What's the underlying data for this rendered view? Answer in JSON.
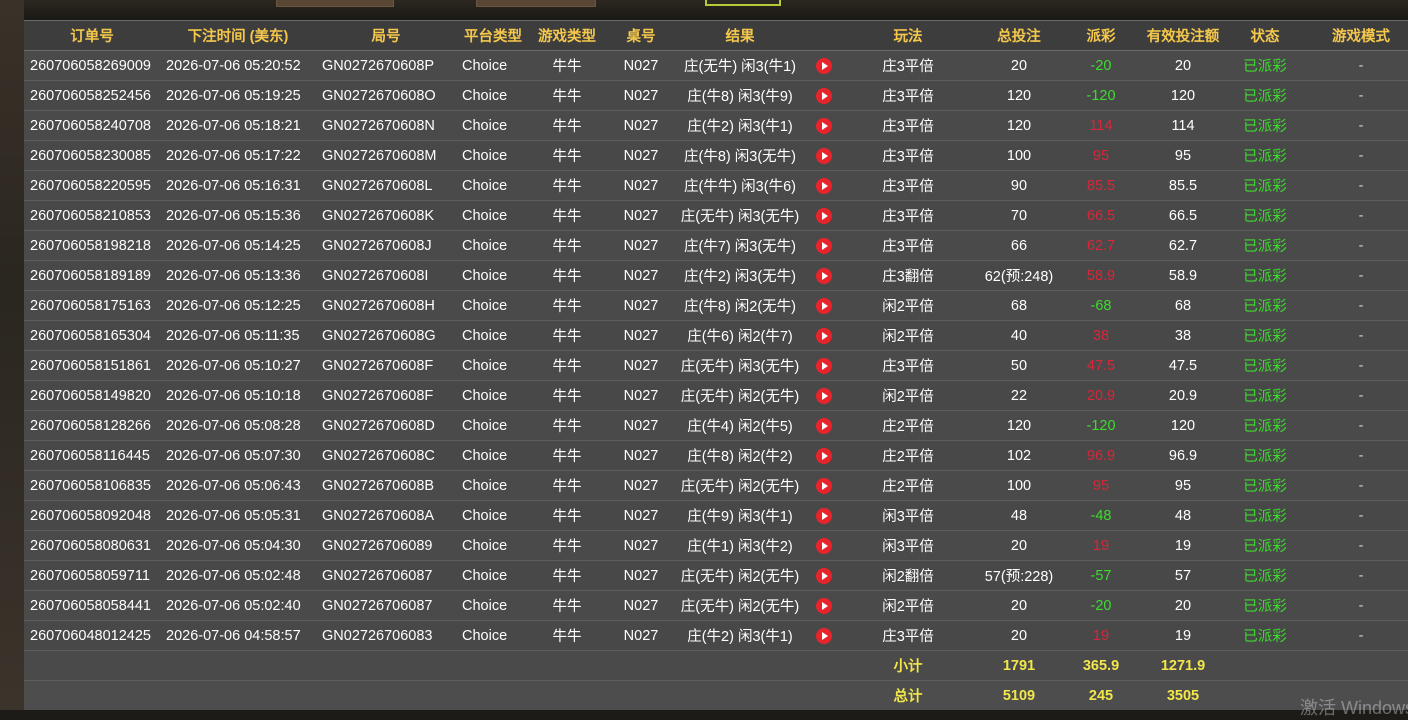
{
  "headers": {
    "order_no": "订单号",
    "bet_time": "下注时间 (美东)",
    "round_no": "局号",
    "platform": "平台类型",
    "game_type": "游戏类型",
    "table_no": "桌号",
    "result": "结果",
    "play_method": "玩法",
    "total_bet": "总投注",
    "payout": "派彩",
    "valid_bet": "有效投注额",
    "status": "状态",
    "game_mode": "游戏模式"
  },
  "rows": [
    {
      "order": "260706058269009",
      "time": "2026-07-06 05:20:52",
      "round": "GN0272670608P",
      "platform": "Choice",
      "game": "牛牛",
      "table": "N027",
      "result": "庄(无牛) 闲3(牛1)",
      "play": "庄3平倍",
      "bet": "20",
      "payout": "-20",
      "payout_color": "green",
      "valid": "20",
      "status": "已派彩",
      "mode": "-"
    },
    {
      "order": "260706058252456",
      "time": "2026-07-06 05:19:25",
      "round": "GN0272670608O",
      "platform": "Choice",
      "game": "牛牛",
      "table": "N027",
      "result": "庄(牛8) 闲3(牛9)",
      "play": "庄3平倍",
      "bet": "120",
      "payout": "-120",
      "payout_color": "green",
      "valid": "120",
      "status": "已派彩",
      "mode": "-"
    },
    {
      "order": "260706058240708",
      "time": "2026-07-06 05:18:21",
      "round": "GN0272670608N",
      "platform": "Choice",
      "game": "牛牛",
      "table": "N027",
      "result": "庄(牛2) 闲3(牛1)",
      "play": "庄3平倍",
      "bet": "120",
      "payout": "114",
      "payout_color": "red",
      "valid": "114",
      "status": "已派彩",
      "mode": "-"
    },
    {
      "order": "260706058230085",
      "time": "2026-07-06 05:17:22",
      "round": "GN0272670608M",
      "platform": "Choice",
      "game": "牛牛",
      "table": "N027",
      "result": "庄(牛8) 闲3(无牛)",
      "play": "庄3平倍",
      "bet": "100",
      "payout": "95",
      "payout_color": "red",
      "valid": "95",
      "status": "已派彩",
      "mode": "-"
    },
    {
      "order": "260706058220595",
      "time": "2026-07-06 05:16:31",
      "round": "GN0272670608L",
      "platform": "Choice",
      "game": "牛牛",
      "table": "N027",
      "result": "庄(牛牛) 闲3(牛6)",
      "play": "庄3平倍",
      "bet": "90",
      "payout": "85.5",
      "payout_color": "red",
      "valid": "85.5",
      "status": "已派彩",
      "mode": "-"
    },
    {
      "order": "260706058210853",
      "time": "2026-07-06 05:15:36",
      "round": "GN0272670608K",
      "platform": "Choice",
      "game": "牛牛",
      "table": "N027",
      "result": "庄(无牛) 闲3(无牛)",
      "play": "庄3平倍",
      "bet": "70",
      "payout": "66.5",
      "payout_color": "red",
      "valid": "66.5",
      "status": "已派彩",
      "mode": "-"
    },
    {
      "order": "260706058198218",
      "time": "2026-07-06 05:14:25",
      "round": "GN0272670608J",
      "platform": "Choice",
      "game": "牛牛",
      "table": "N027",
      "result": "庄(牛7) 闲3(无牛)",
      "play": "庄3平倍",
      "bet": "66",
      "payout": "62.7",
      "payout_color": "red",
      "valid": "62.7",
      "status": "已派彩",
      "mode": "-"
    },
    {
      "order": "260706058189189",
      "time": "2026-07-06 05:13:36",
      "round": "GN0272670608I",
      "platform": "Choice",
      "game": "牛牛",
      "table": "N027",
      "result": "庄(牛2) 闲3(无牛)",
      "play": "庄3翻倍",
      "bet": "62(预:248)",
      "payout": "58.9",
      "payout_color": "red",
      "valid": "58.9",
      "status": "已派彩",
      "mode": "-"
    },
    {
      "order": "260706058175163",
      "time": "2026-07-06 05:12:25",
      "round": "GN0272670608H",
      "platform": "Choice",
      "game": "牛牛",
      "table": "N027",
      "result": "庄(牛8) 闲2(无牛)",
      "play": "闲2平倍",
      "bet": "68",
      "payout": "-68",
      "payout_color": "green",
      "valid": "68",
      "status": "已派彩",
      "mode": "-"
    },
    {
      "order": "260706058165304",
      "time": "2026-07-06 05:11:35",
      "round": "GN0272670608G",
      "platform": "Choice",
      "game": "牛牛",
      "table": "N027",
      "result": "庄(牛6) 闲2(牛7)",
      "play": "闲2平倍",
      "bet": "40",
      "payout": "38",
      "payout_color": "red",
      "valid": "38",
      "status": "已派彩",
      "mode": "-"
    },
    {
      "order": "260706058151861",
      "time": "2026-07-06 05:10:27",
      "round": "GN0272670608F",
      "platform": "Choice",
      "game": "牛牛",
      "table": "N027",
      "result": "庄(无牛) 闲3(无牛)",
      "play": "庄3平倍",
      "bet": "50",
      "payout": "47.5",
      "payout_color": "red",
      "valid": "47.5",
      "status": "已派彩",
      "mode": "-"
    },
    {
      "order": "260706058149820",
      "time": "2026-07-06 05:10:18",
      "round": "GN0272670608F",
      "platform": "Choice",
      "game": "牛牛",
      "table": "N027",
      "result": "庄(无牛) 闲2(无牛)",
      "play": "闲2平倍",
      "bet": "22",
      "payout": "20.9",
      "payout_color": "red",
      "valid": "20.9",
      "status": "已派彩",
      "mode": "-"
    },
    {
      "order": "260706058128266",
      "time": "2026-07-06 05:08:28",
      "round": "GN0272670608D",
      "platform": "Choice",
      "game": "牛牛",
      "table": "N027",
      "result": "庄(牛4) 闲2(牛5)",
      "play": "庄2平倍",
      "bet": "120",
      "payout": "-120",
      "payout_color": "green",
      "valid": "120",
      "status": "已派彩",
      "mode": "-"
    },
    {
      "order": "260706058116445",
      "time": "2026-07-06 05:07:30",
      "round": "GN0272670608C",
      "platform": "Choice",
      "game": "牛牛",
      "table": "N027",
      "result": "庄(牛8) 闲2(牛2)",
      "play": "庄2平倍",
      "bet": "102",
      "payout": "96.9",
      "payout_color": "red",
      "valid": "96.9",
      "status": "已派彩",
      "mode": "-"
    },
    {
      "order": "260706058106835",
      "time": "2026-07-06 05:06:43",
      "round": "GN0272670608B",
      "platform": "Choice",
      "game": "牛牛",
      "table": "N027",
      "result": "庄(无牛) 闲2(无牛)",
      "play": "庄2平倍",
      "bet": "100",
      "payout": "95",
      "payout_color": "red",
      "valid": "95",
      "status": "已派彩",
      "mode": "-"
    },
    {
      "order": "260706058092048",
      "time": "2026-07-06 05:05:31",
      "round": "GN0272670608A",
      "platform": "Choice",
      "game": "牛牛",
      "table": "N027",
      "result": "庄(牛9) 闲3(牛1)",
      "play": "闲3平倍",
      "bet": "48",
      "payout": "-48",
      "payout_color": "green",
      "valid": "48",
      "status": "已派彩",
      "mode": "-"
    },
    {
      "order": "260706058080631",
      "time": "2026-07-06 05:04:30",
      "round": "GN02726706089",
      "platform": "Choice",
      "game": "牛牛",
      "table": "N027",
      "result": "庄(牛1) 闲3(牛2)",
      "play": "闲3平倍",
      "bet": "20",
      "payout": "19",
      "payout_color": "red",
      "valid": "19",
      "status": "已派彩",
      "mode": "-"
    },
    {
      "order": "260706058059711",
      "time": "2026-07-06 05:02:48",
      "round": "GN02726706087",
      "platform": "Choice",
      "game": "牛牛",
      "table": "N027",
      "result": "庄(无牛) 闲2(无牛)",
      "play": "闲2翻倍",
      "bet": "57(预:228)",
      "payout": "-57",
      "payout_color": "green",
      "valid": "57",
      "status": "已派彩",
      "mode": "-"
    },
    {
      "order": "260706058058441",
      "time": "2026-07-06 05:02:40",
      "round": "GN02726706087",
      "platform": "Choice",
      "game": "牛牛",
      "table": "N027",
      "result": "庄(无牛) 闲2(无牛)",
      "play": "闲2平倍",
      "bet": "20",
      "payout": "-20",
      "payout_color": "green",
      "valid": "20",
      "status": "已派彩",
      "mode": "-"
    },
    {
      "order": "260706048012425",
      "time": "2026-07-06 04:58:57",
      "round": "GN02726706083",
      "platform": "Choice",
      "game": "牛牛",
      "table": "N027",
      "result": "庄(牛2) 闲3(牛1)",
      "play": "庄3平倍",
      "bet": "20",
      "payout": "19",
      "payout_color": "red",
      "valid": "19",
      "status": "已派彩",
      "mode": "-"
    }
  ],
  "subtotal": {
    "label": "小计",
    "bet": "1791",
    "payout": "365.9",
    "valid": "1271.9"
  },
  "total": {
    "label": "总计",
    "bet": "5109",
    "payout": "245",
    "valid": "3505"
  },
  "watermark": "激活 Windows",
  "colors": {
    "header_text": "#f5c84c",
    "sum_text": "#f2e64a",
    "win": "#3ddc2e",
    "loss": "#d9263a",
    "status": "#3ddc2e"
  }
}
